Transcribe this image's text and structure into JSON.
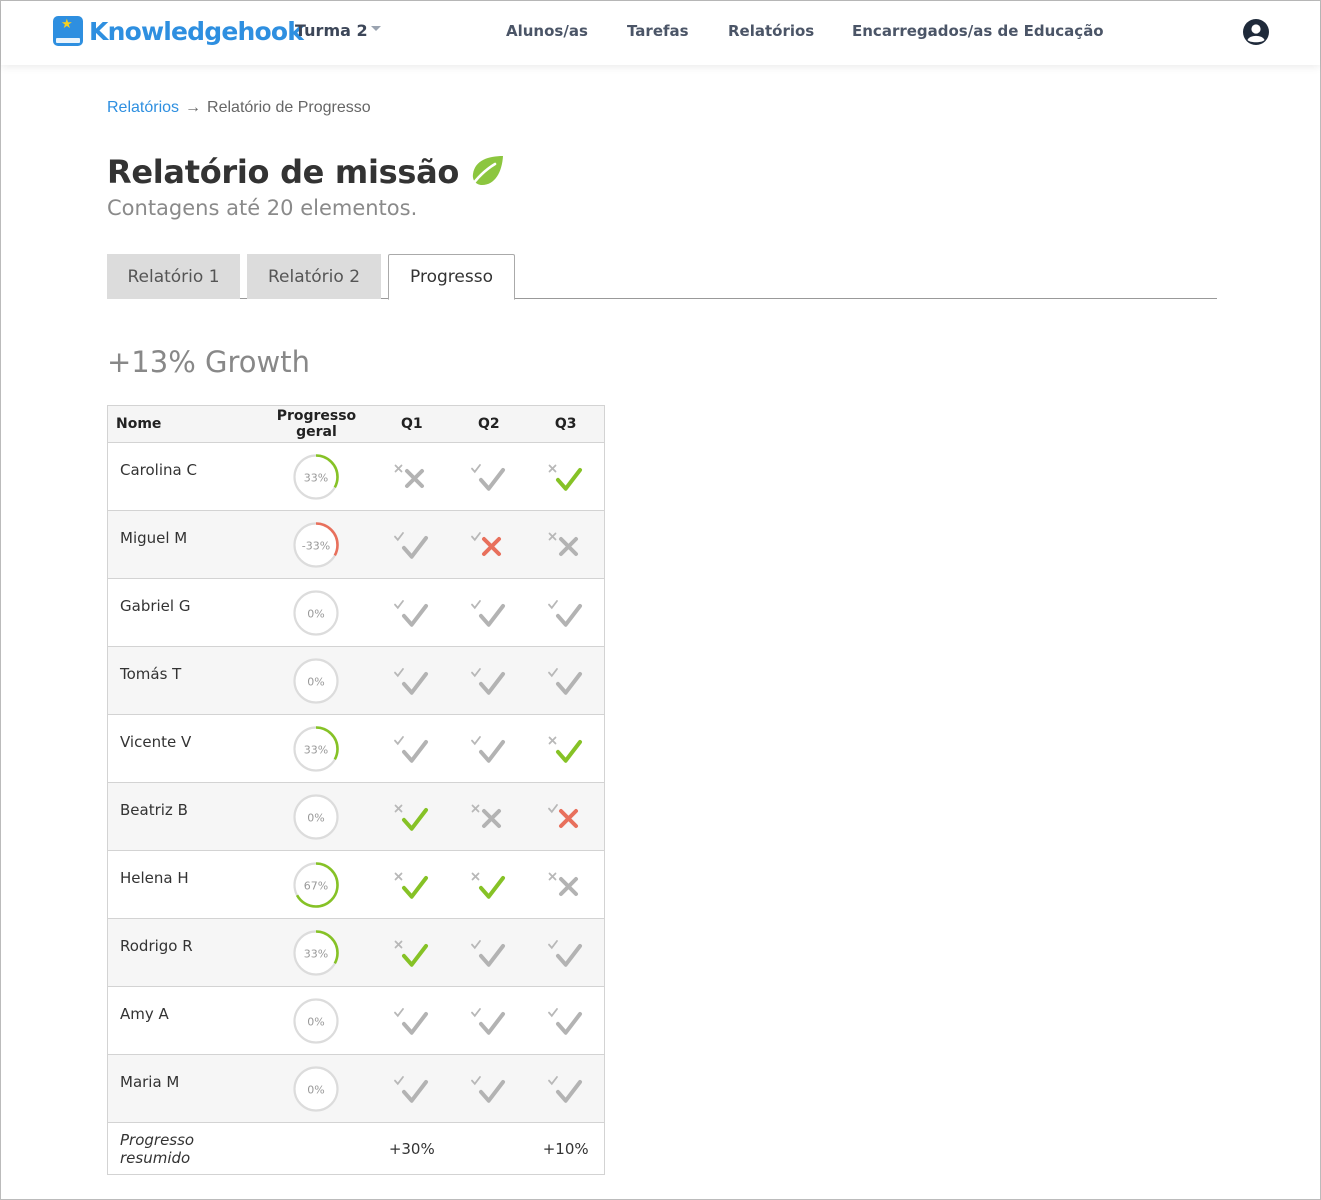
{
  "nav": {
    "brand": "Knowledgehook",
    "class_selector": "Turma 2",
    "links": [
      "Alunos/as",
      "Tarefas",
      "Relatórios",
      "Encarregados/as de Educação"
    ]
  },
  "breadcrumb": {
    "parent": "Relatórios",
    "arrow": "→",
    "current": "Relatório de Progresso"
  },
  "page": {
    "title": "Relatório de missão",
    "subtitle": "Contagens até 20 elementos.",
    "growth": "+13% Growth"
  },
  "tabs": [
    {
      "label": "Relatório 1",
      "active": false
    },
    {
      "label": "Relatório 2",
      "active": false
    },
    {
      "label": "Progresso",
      "active": true
    }
  ],
  "table": {
    "headers": {
      "name": "Nome",
      "progress": "Progresso geral",
      "q1": "Q1",
      "q2": "Q2",
      "q3": "Q3"
    },
    "rows": [
      {
        "name": "Carolina C",
        "progress": 33,
        "progress_label": "33%",
        "q1": [
          "x",
          "x",
          "grey"
        ],
        "q2": [
          "c",
          "c",
          "grey"
        ],
        "q3": [
          "x",
          "c",
          "green"
        ]
      },
      {
        "name": "Miguel M",
        "progress": -33,
        "progress_label": "-33%",
        "q1": [
          "c",
          "c",
          "grey"
        ],
        "q2": [
          "c",
          "x",
          "red"
        ],
        "q3": [
          "x",
          "x",
          "grey"
        ]
      },
      {
        "name": "Gabriel G",
        "progress": 0,
        "progress_label": "0%",
        "q1": [
          "c",
          "c",
          "grey"
        ],
        "q2": [
          "c",
          "c",
          "grey"
        ],
        "q3": [
          "c",
          "c",
          "grey"
        ]
      },
      {
        "name": "Tomás T",
        "progress": 0,
        "progress_label": "0%",
        "q1": [
          "c",
          "c",
          "grey"
        ],
        "q2": [
          "c",
          "c",
          "grey"
        ],
        "q3": [
          "c",
          "c",
          "grey"
        ]
      },
      {
        "name": "Vicente V",
        "progress": 33,
        "progress_label": "33%",
        "q1": [
          "c",
          "c",
          "grey"
        ],
        "q2": [
          "c",
          "c",
          "grey"
        ],
        "q3": [
          "x",
          "c",
          "green"
        ]
      },
      {
        "name": "Beatriz B",
        "progress": 0,
        "progress_label": "0%",
        "q1": [
          "x",
          "c",
          "green"
        ],
        "q2": [
          "x",
          "x",
          "grey"
        ],
        "q3": [
          "c",
          "x",
          "red"
        ]
      },
      {
        "name": "Helena H",
        "progress": 67,
        "progress_label": "67%",
        "q1": [
          "x",
          "c",
          "green"
        ],
        "q2": [
          "x",
          "c",
          "green"
        ],
        "q3": [
          "x",
          "x",
          "grey"
        ]
      },
      {
        "name": "Rodrigo R",
        "progress": 33,
        "progress_label": "33%",
        "q1": [
          "x",
          "c",
          "green"
        ],
        "q2": [
          "c",
          "c",
          "grey"
        ],
        "q3": [
          "c",
          "c",
          "grey"
        ]
      },
      {
        "name": "Amy A",
        "progress": 0,
        "progress_label": "0%",
        "q1": [
          "c",
          "c",
          "grey"
        ],
        "q2": [
          "c",
          "c",
          "grey"
        ],
        "q3": [
          "c",
          "c",
          "grey"
        ]
      },
      {
        "name": "Maria M",
        "progress": 0,
        "progress_label": "0%",
        "q1": [
          "c",
          "c",
          "grey"
        ],
        "q2": [
          "c",
          "c",
          "grey"
        ],
        "q3": [
          "c",
          "c",
          "grey"
        ]
      }
    ],
    "summary": {
      "label": "Progresso resumido",
      "q1": "+30%",
      "q2": "",
      "q3": "+10%"
    }
  },
  "colors": {
    "brand": "#2e8fe0",
    "green": "#86c226",
    "red": "#e8705c",
    "grey": "#b3b3b3",
    "ring_track": "#dcdcdc"
  },
  "icons": {
    "avatar": "user-circle-icon",
    "title_icon": "leaf-icon",
    "marks": "check-icon / cross-icon"
  }
}
